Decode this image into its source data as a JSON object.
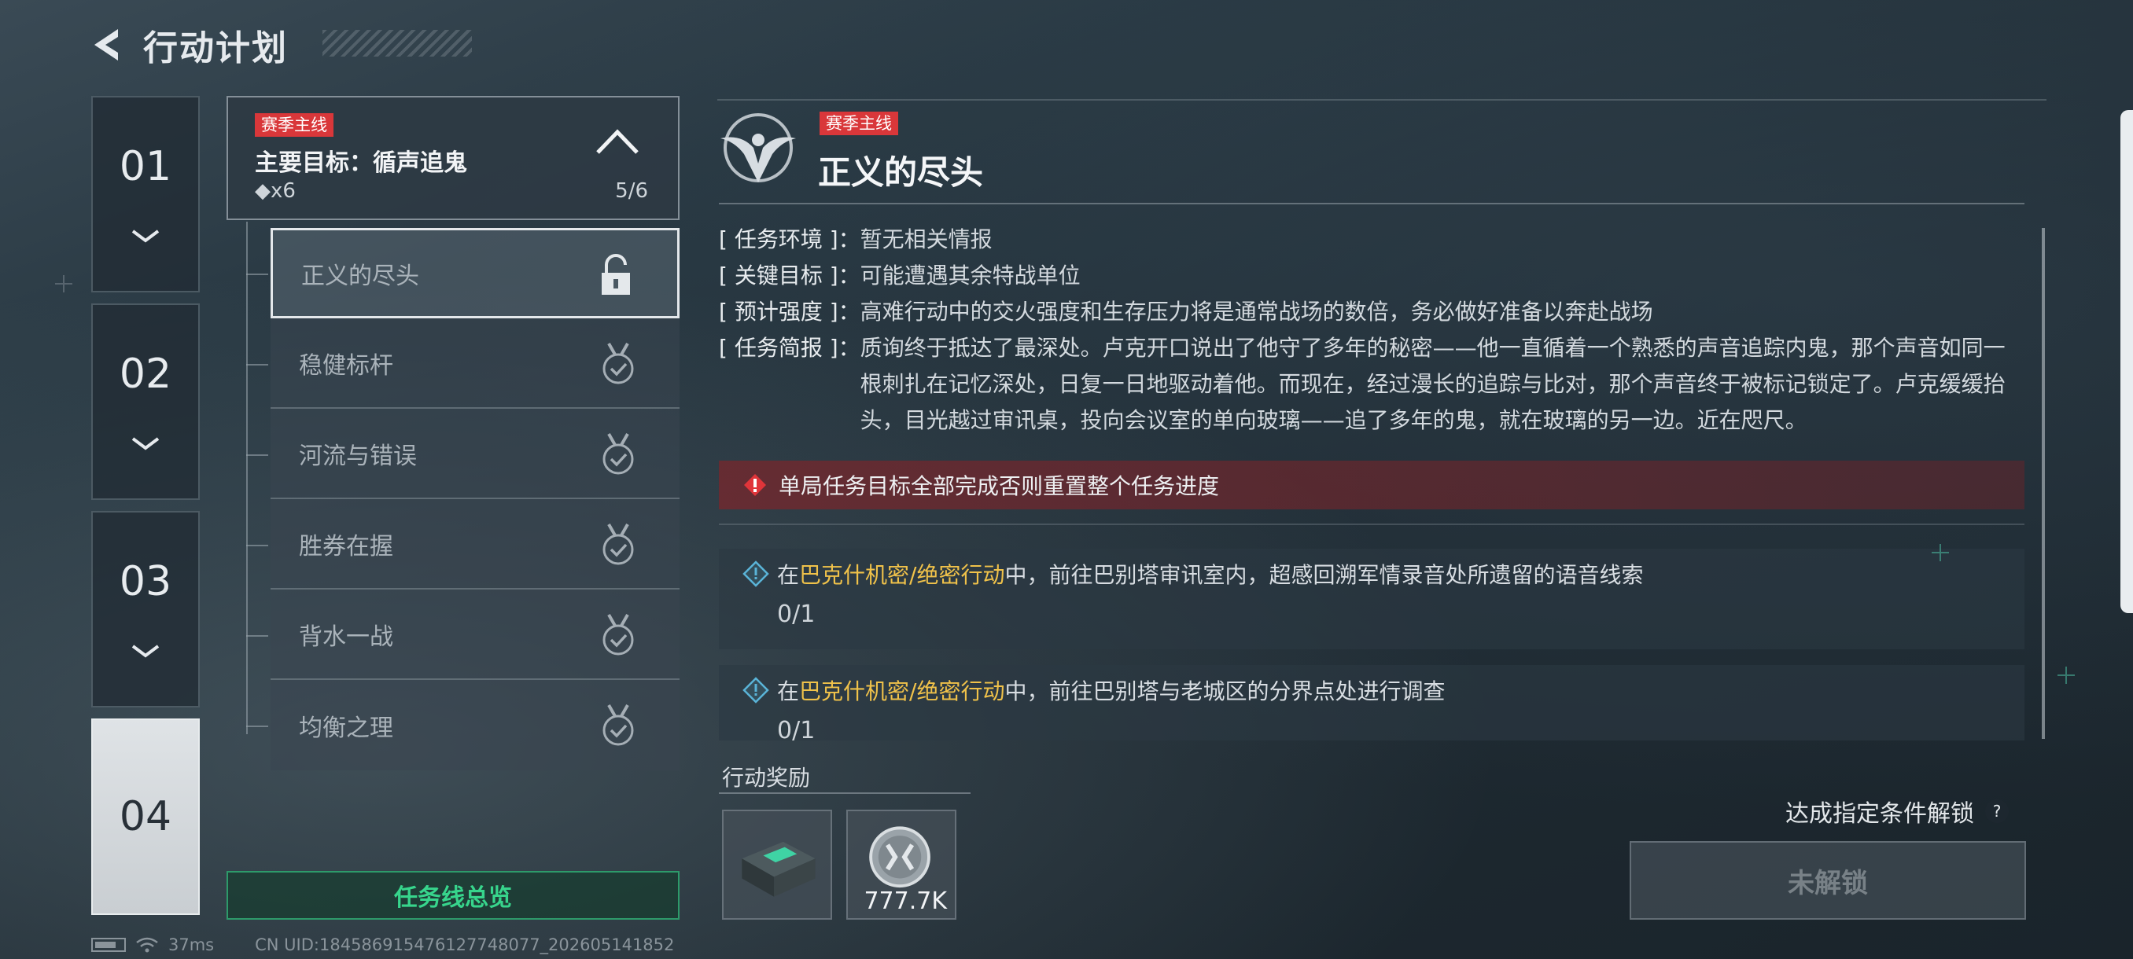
{
  "header": {
    "title": "行动计划"
  },
  "chapters": [
    "01",
    "02",
    "03",
    "04"
  ],
  "mission": {
    "tag": "赛季主线",
    "title": "主要目标：循声追鬼",
    "reward": "◆x6",
    "progress": "5/6",
    "sub_items": [
      {
        "label": "正义的尽头",
        "status": "unlocked"
      },
      {
        "label": "稳健标杆",
        "status": "completed"
      },
      {
        "label": "河流与错误",
        "status": "completed"
      },
      {
        "label": "胜券在握",
        "status": "completed"
      },
      {
        "label": "背水一战",
        "status": "completed"
      },
      {
        "label": "均衡之理",
        "status": "completed"
      }
    ],
    "overview_button": "任务线总览"
  },
  "detail": {
    "tag": "赛季主线",
    "title": "正义的尽头",
    "info": [
      {
        "key": "[ 任务环境 ]：",
        "value": "暂无相关情报"
      },
      {
        "key": "[ 关键目标 ]：",
        "value": "可能遭遇其余特战单位"
      },
      {
        "key": "[ 预计强度 ]：",
        "value": "高难行动中的交火强度和生存压力将是通常战场的数倍，务必做好准备以奔赴战场"
      },
      {
        "key": "[ 任务简报 ]：",
        "value": "质询终于抵达了最深处。卢克开口说出了他守了多年的秘密——他一直循着一个熟悉的声音追踪内鬼，那个声音如同一根刺扎在记忆深处，日复一日地驱动着他。而现在，经过漫长的追踪与比对，那个声音终于被标记锁定了。卢克缓缓抬头，目光越过审讯桌，投向会议室的单向玻璃——追了多年的鬼，就在玻璃的另一边。近在咫尺。"
      }
    ],
    "warning": "单局任务目标全部完成否则重置整个任务进度",
    "objectives": [
      {
        "prefix": "在",
        "highlight": "巴克什机密/绝密行动",
        "suffix": "中，前往巴别塔审讯室内，超感回溯军情录音处所遗留的语音线索",
        "progress": "0/1"
      },
      {
        "prefix": "在",
        "highlight": "巴克什机密/绝密行动",
        "suffix": "中，前往巴别塔与老城区的分界点处进行调查",
        "progress": "0/1"
      }
    ],
    "reward_label": "行动奖励",
    "rewards": [
      {
        "icon": "supply-box-icon",
        "count": ""
      },
      {
        "icon": "coin-icon",
        "count": "777.7K"
      }
    ],
    "unlock_hint": "达成指定条件解锁",
    "help": "?",
    "locked_button": "未解锁"
  },
  "footer": {
    "ping": "37ms",
    "uid": "CN UID:18458691547612774807​7_202605141852"
  },
  "colors": {
    "accent_red": "#d9373a",
    "accent_green": "#37d58c",
    "highlight_gold": "#f0c24a"
  }
}
